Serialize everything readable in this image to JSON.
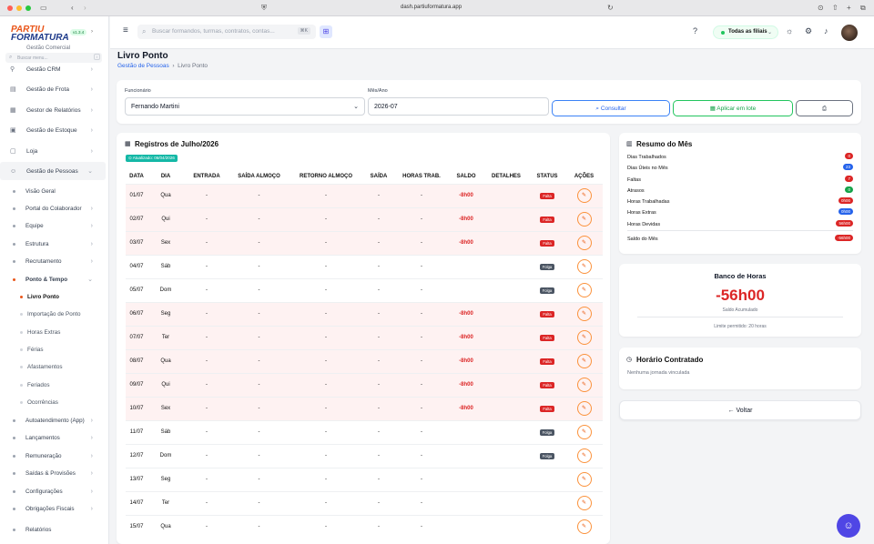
{
  "browser": {
    "url": "dash.partiuformatura.app"
  },
  "app": {
    "logo_line1": "PARTIU",
    "logo_line2": "FORMATURA",
    "version": "v1.3.4"
  },
  "sidebar": {
    "search_placeholder": "Buscar menu...",
    "search_shortcut": "/",
    "top_cut": "Gestão Comercial",
    "items": [
      {
        "label": "Gestão CRM"
      },
      {
        "label": "Gestão de Frota"
      },
      {
        "label": "Gestor de Relatórios"
      },
      {
        "label": "Gestão de Estoque"
      },
      {
        "label": "Loja"
      },
      {
        "label": "Gestão de Pessoas"
      }
    ],
    "subitems": [
      {
        "label": "Visão Geral"
      },
      {
        "label": "Portal do Colaborador"
      },
      {
        "label": "Equipe"
      },
      {
        "label": "Estrutura"
      },
      {
        "label": "Recrutamento"
      },
      {
        "label": "Ponto & Tempo"
      }
    ],
    "ponto_items": [
      {
        "label": "Livro Ponto"
      },
      {
        "label": "Importação de Ponto"
      },
      {
        "label": "Horas Extras"
      },
      {
        "label": "Férias"
      },
      {
        "label": "Afastamentos"
      },
      {
        "label": "Feriados"
      },
      {
        "label": "Ocorrências"
      }
    ],
    "more_items": [
      {
        "label": "Autoatendimento (App)"
      },
      {
        "label": "Lançamentos"
      },
      {
        "label": "Remuneração"
      },
      {
        "label": "Saídas & Provisões"
      },
      {
        "label": "Configurações"
      },
      {
        "label": "Obrigações Fiscais"
      }
    ],
    "bottom_item": "Relatórios"
  },
  "topbar": {
    "search_placeholder": "Buscar formandos, turmas, contratos, contas...",
    "search_shortcut": "⌘K",
    "filial": "Todas as filiais"
  },
  "page": {
    "title": "Livro Ponto",
    "breadcrumb_parent": "Gestão de Pessoas",
    "breadcrumb_current": "Livro Ponto"
  },
  "filters": {
    "funcionario_label": "Funcionário",
    "funcionario_value": "Fernando Martini",
    "mes_label": "Mês/Ano",
    "mes_value": "2026-07",
    "consultar": "Consultar",
    "aplicar": "Aplicar em lote"
  },
  "registros": {
    "title": "Registros de Julho/2026",
    "badge": "Atualizado: 06/04/2026",
    "headers": [
      "DATA",
      "DIA",
      "ENTRADA",
      "SAÍDA ALMOÇO",
      "RETORNO ALMOÇO",
      "SAÍDA",
      "HORAS TRAB.",
      "SALDO",
      "DETALHES",
      "STATUS",
      "AÇÕES"
    ],
    "rows": [
      {
        "data": "01/07",
        "dia": "Qua",
        "entrada": "-",
        "saida_alm": "-",
        "retorno": "-",
        "saida": "-",
        "horas": "-",
        "saldo": "-8h00",
        "status": "Falta",
        "tipo": "falta"
      },
      {
        "data": "02/07",
        "dia": "Qui",
        "entrada": "-",
        "saida_alm": "-",
        "retorno": "-",
        "saida": "-",
        "horas": "-",
        "saldo": "-8h00",
        "status": "Falta",
        "tipo": "falta"
      },
      {
        "data": "03/07",
        "dia": "Sex",
        "entrada": "-",
        "saida_alm": "-",
        "retorno": "-",
        "saida": "-",
        "horas": "-",
        "saldo": "-8h00",
        "status": "Falta",
        "tipo": "falta"
      },
      {
        "data": "04/07",
        "dia": "Sáb",
        "entrada": "-",
        "saida_alm": "-",
        "retorno": "-",
        "saida": "-",
        "horas": "-",
        "saldo": "",
        "status": "Folga",
        "tipo": "folga"
      },
      {
        "data": "05/07",
        "dia": "Dom",
        "entrada": "-",
        "saida_alm": "-",
        "retorno": "-",
        "saida": "-",
        "horas": "-",
        "saldo": "",
        "status": "Folga",
        "tipo": "folga"
      },
      {
        "data": "06/07",
        "dia": "Seg",
        "entrada": "-",
        "saida_alm": "-",
        "retorno": "-",
        "saida": "-",
        "horas": "-",
        "saldo": "-8h00",
        "status": "Falta",
        "tipo": "falta"
      },
      {
        "data": "07/07",
        "dia": "Ter",
        "entrada": "-",
        "saida_alm": "-",
        "retorno": "-",
        "saida": "-",
        "horas": "-",
        "saldo": "-8h00",
        "status": "Falta",
        "tipo": "falta"
      },
      {
        "data": "08/07",
        "dia": "Qua",
        "entrada": "-",
        "saida_alm": "-",
        "retorno": "-",
        "saida": "-",
        "horas": "-",
        "saldo": "-8h00",
        "status": "Falta",
        "tipo": "falta"
      },
      {
        "data": "09/07",
        "dia": "Qui",
        "entrada": "-",
        "saida_alm": "-",
        "retorno": "-",
        "saida": "-",
        "horas": "-",
        "saldo": "-8h00",
        "status": "Falta",
        "tipo": "falta"
      },
      {
        "data": "10/07",
        "dia": "Sex",
        "entrada": "-",
        "saida_alm": "-",
        "retorno": "-",
        "saida": "-",
        "horas": "-",
        "saldo": "-8h00",
        "status": "Falta",
        "tipo": "falta"
      },
      {
        "data": "11/07",
        "dia": "Sáb",
        "entrada": "-",
        "saida_alm": "-",
        "retorno": "-",
        "saida": "-",
        "horas": "-",
        "saldo": "",
        "status": "Folga",
        "tipo": "folga"
      },
      {
        "data": "12/07",
        "dia": "Dom",
        "entrada": "-",
        "saida_alm": "-",
        "retorno": "-",
        "saida": "-",
        "horas": "-",
        "saldo": "",
        "status": "Folga",
        "tipo": "folga"
      },
      {
        "data": "13/07",
        "dia": "Seg",
        "entrada": "-",
        "saida_alm": "-",
        "retorno": "-",
        "saida": "-",
        "horas": "-",
        "saldo": "",
        "status": "",
        "tipo": "none"
      },
      {
        "data": "14/07",
        "dia": "Ter",
        "entrada": "-",
        "saida_alm": "-",
        "retorno": "-",
        "saida": "-",
        "horas": "-",
        "saldo": "",
        "status": "",
        "tipo": "none"
      },
      {
        "data": "15/07",
        "dia": "Qua",
        "entrada": "-",
        "saida_alm": "-",
        "retorno": "-",
        "saida": "-",
        "horas": "-",
        "saldo": "",
        "status": "",
        "tipo": "none"
      }
    ]
  },
  "resumo": {
    "title": "Resumo do Mês",
    "rows": [
      {
        "label": "Dias Trabalhados",
        "value": "0",
        "color": "#dc2626"
      },
      {
        "label": "Dias Úteis no Mês",
        "value": "23",
        "color": "#2563eb"
      },
      {
        "label": "Faltas",
        "value": "7",
        "color": "#dc2626"
      },
      {
        "label": "Atrasos",
        "value": "0",
        "color": "#16a34a"
      },
      {
        "label": "Horas Trabalhadas",
        "value": "0h00",
        "color": "#dc2626"
      },
      {
        "label": "Horas Extras",
        "value": "0h00",
        "color": "#2563eb"
      },
      {
        "label": "Horas Devidas",
        "value": "56h00",
        "color": "#dc2626"
      },
      {
        "label": "Saldo do Mês",
        "value": "-56h00",
        "color": "#dc2626"
      }
    ]
  },
  "banco": {
    "title": "Banco de Horas",
    "value": "-56h00",
    "sub": "Saldo Acumulado",
    "limit": "Limite permitido: 20 horas"
  },
  "horario": {
    "title": "Horário Contratado",
    "text": "Nenhuma jornada vinculada"
  },
  "voltar": "Voltar"
}
